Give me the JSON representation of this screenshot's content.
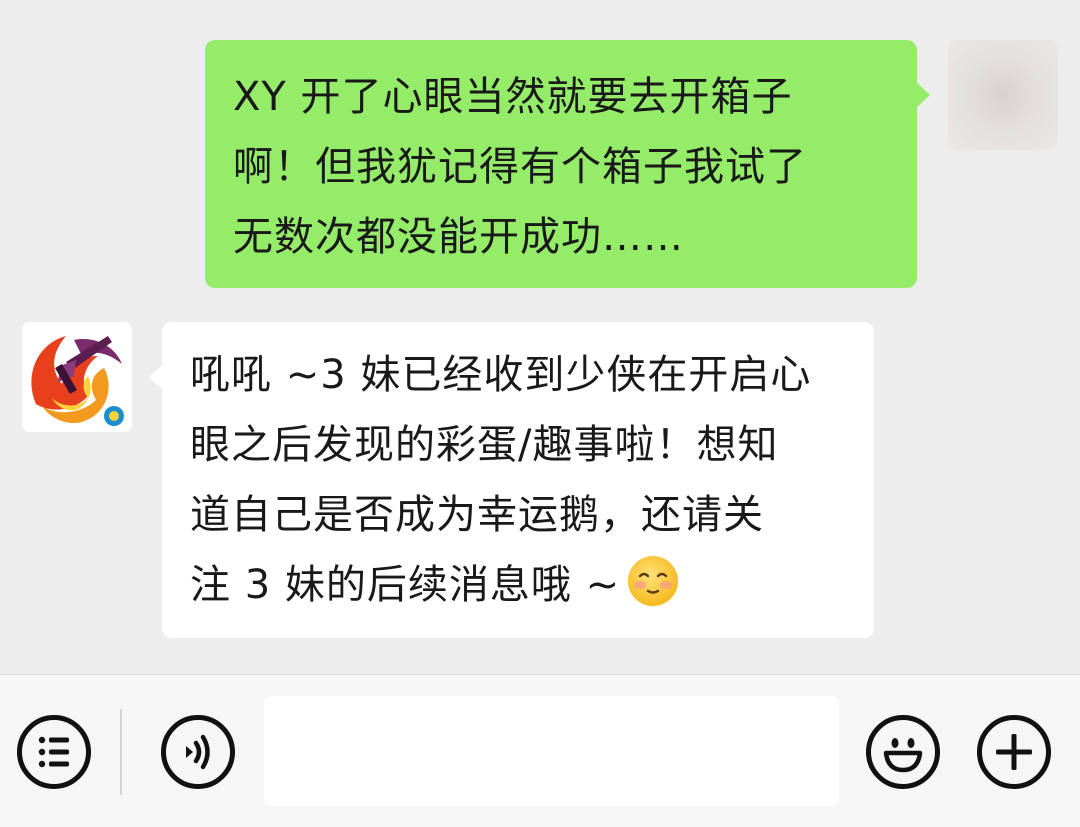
{
  "conversation": {
    "messages": [
      {
        "direction": "outgoing",
        "text": "XY 开了心眼当然就要去开箱子\n啊！但我犹记得有个箱子我试了\n无数次都没能开成功……",
        "bubble_color": "#95ec69"
      },
      {
        "direction": "incoming",
        "text": "吼吼 ~3 妹已经收到少侠在开启心\n眼之后发现的彩蛋/趣事啦！想知\n道自己是否成为幸运鹅，还请关\n注 3 妹的后续消息哦 ~",
        "emoji": "blushing-smile-emoji",
        "bubble_color": "#ffffff"
      }
    ]
  },
  "input_bar": {
    "menu_icon": "menu-list-icon",
    "voice_icon": "voice-icon",
    "message_input_value": "",
    "emoji_icon": "smiley-icon",
    "plus_icon": "plus-icon"
  },
  "colors": {
    "chat_background": "#ededed",
    "outgoing_bubble": "#95ec69",
    "incoming_bubble": "#ffffff",
    "input_bar_background": "#f6f6f6"
  }
}
